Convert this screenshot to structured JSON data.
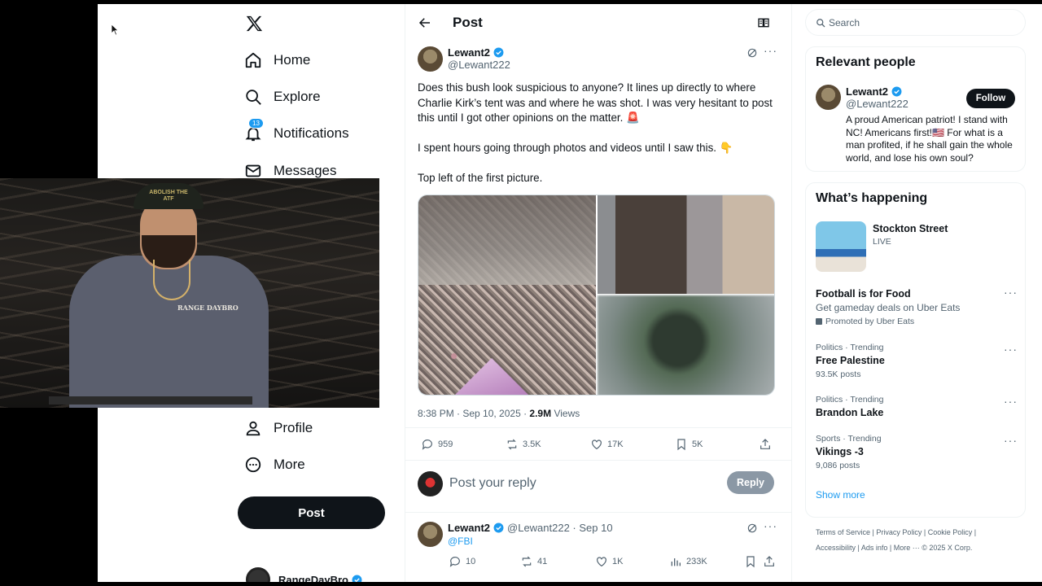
{
  "nav": {
    "items": [
      {
        "label": "Home",
        "icon": "home-icon"
      },
      {
        "label": "Explore",
        "icon": "search-icon"
      },
      {
        "label": "Notifications",
        "icon": "bell-icon",
        "badge": "13"
      },
      {
        "label": "Messages",
        "icon": "mail-icon"
      },
      {
        "label": "Profile",
        "icon": "person-icon"
      },
      {
        "label": "More",
        "icon": "more-circle-icon"
      }
    ],
    "post_button": "Post",
    "account_name": "RangeDayBro"
  },
  "header": {
    "title": "Post"
  },
  "tweet": {
    "name": "Lewant2",
    "handle": "@Lewant222",
    "paragraphs": [
      "Does this bush look suspicious to anyone? It lines up directly to where Charlie Kirk’s tent was and where he was shot. I was very hesitant to post this until I got other opinions on the matter. 🚨",
      "I spent hours going through photos and videos until I saw this. 👇",
      "Top left of the first picture."
    ],
    "time": "8:38 PM · Sep 10, 2025 · ",
    "views_count": "2.9M",
    "views_label": "Views",
    "stats": {
      "replies": "959",
      "reposts": "3.5K",
      "likes": "17K",
      "bookmarks": "5K"
    }
  },
  "reply_box": {
    "placeholder": "Post your reply",
    "button": "Reply"
  },
  "reply_tweet": {
    "name": "Lewant2",
    "handle": "@Lewant222 · Sep 10",
    "text": "@FBI",
    "stats": {
      "replies": "10",
      "reposts": "41",
      "likes": "1K",
      "views": "233K"
    }
  },
  "sidebar": {
    "search_placeholder": "Search",
    "relevant_title": "Relevant people",
    "person": {
      "name": "Lewant2",
      "handle": "@Lewant222",
      "follow": "Follow",
      "bio": "A proud American patriot! I stand with NC! Americans first!🇺🇸 For what is a man profited, if he shall gain the whole world, and lose his own soul?"
    },
    "happening_title": "What’s happening",
    "live": {
      "title": "Stockton Street",
      "status": "LIVE"
    },
    "promo": {
      "title": "Football is for Food",
      "desc": "Get gameday deals on Uber Eats",
      "by": "Promoted by Uber Eats"
    },
    "trends": [
      {
        "context": "Politics · Trending",
        "name": "Free Palestine",
        "count": "93.5K posts"
      },
      {
        "context": "Politics · Trending",
        "name": "Brandon Lake",
        "count": ""
      },
      {
        "context": "Sports · Trending",
        "name": "Vikings -3",
        "count": "9,086 posts"
      }
    ],
    "show_more": "Show more",
    "footer_line1": "Terms of Service  |   Privacy Policy  |   Cookie Policy  |",
    "footer_line2": "Accessibility  |   Ads info  |   More ···   © 2025 X Corp."
  },
  "webcam": {
    "cap_text": "ABOLISH THE ATF",
    "shirt_text": "RANGE DAYBRO"
  },
  "colors": {
    "accent": "#1d9bf0",
    "text": "#0f1419",
    "muted": "#536471"
  }
}
